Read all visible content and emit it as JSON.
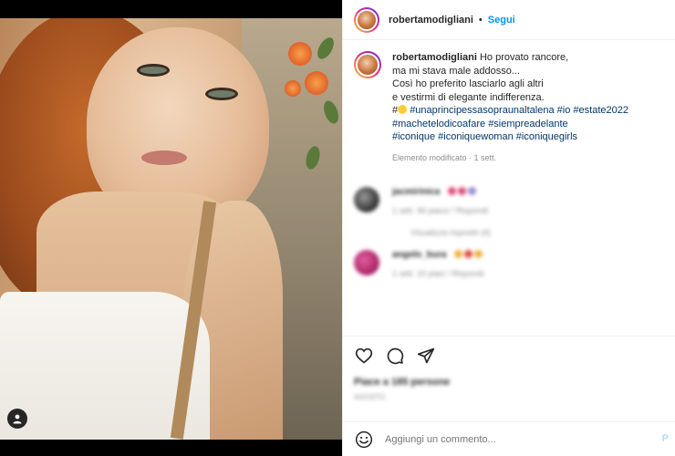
{
  "header": {
    "username": "robertamodigliani",
    "separator": "•",
    "follow_label": "Segui"
  },
  "caption": {
    "username": "robertamodigliani",
    "line1": "Ho provato rancore,",
    "line2": "ma mi stava male addosso...",
    "line3": "Così ho preferito lasciarlo agli altri",
    "line4": "e vestirmi di elegante indifferenza.",
    "hashtags_line1": [
      "#unaprincipessasopraunaltalena",
      "#io",
      "#estate2022"
    ],
    "hashtags_line2": [
      "#machetelodicoafare",
      "#siempreadelante"
    ],
    "hashtags_line3": [
      "#iconique",
      "#iconiquewoman",
      "#iconiquegirls"
    ],
    "edited_label": "Elemento modificato",
    "time_label": "1 sett."
  },
  "comments": [
    {
      "username": "jacmirinica",
      "meta": "1 sett.   96 piacci !   Rispondi",
      "replies": "Visualizza risposte (4)",
      "avatar_color": "#4a4a4a",
      "hearts": [
        "#e04a7a",
        "#e04a7a",
        "#9a8ad6"
      ]
    },
    {
      "username": "angelo_bura",
      "meta": "1 sett.   10 piaci !   Rispondi",
      "replies": "",
      "avatar_color": "#b0286a",
      "hearts": [
        "#f0b23a",
        "#e04a3a",
        "#f0b23a"
      ]
    }
  ],
  "actions": {
    "like_icon": "heart-icon",
    "comment_icon": "comment-icon",
    "share_icon": "share-icon",
    "likes_text": "Piace a 185 persone",
    "date_text": "AGOSTO"
  },
  "add_comment": {
    "placeholder": "Aggiungi un commento...",
    "post_label": "P"
  },
  "colors": {
    "accent": "#0095f6",
    "hashtag": "#00376b",
    "muted": "#8e8e8e"
  }
}
